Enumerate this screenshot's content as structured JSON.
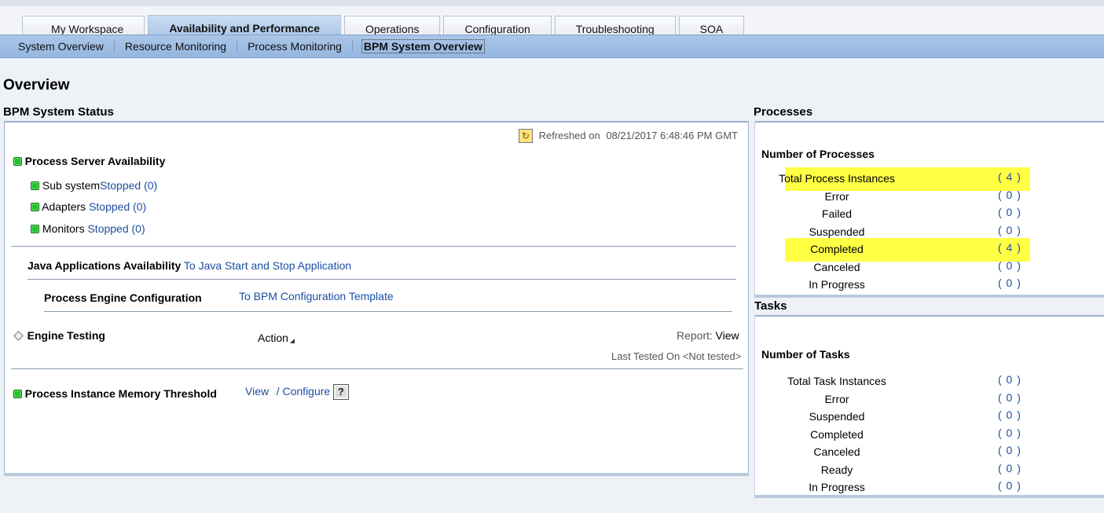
{
  "tabs": [
    "My Workspace",
    "Availability and Performance",
    "Operations",
    "Configuration",
    "Troubleshooting",
    "SOA"
  ],
  "active_tab": "Availability and Performance",
  "subnav": [
    "System Overview",
    "Resource Monitoring",
    "Process Monitoring",
    "BPM System Overview"
  ],
  "active_subnav": "BPM System Overview",
  "page_title": "Overview",
  "status": {
    "title": "BPM System Status",
    "refreshed_label": "Refreshed on",
    "refreshed_value": "08/21/2017 6:48:46 PM GMT",
    "server_availability": "Process Server Availability",
    "subsystem_label": "Sub system",
    "subsystem_link": "Stopped (0)",
    "adapters_label": "Adapters",
    "adapters_link": "Stopped (0)",
    "monitors_label": "Monitors",
    "monitors_link": "Stopped (0)",
    "java_label": "Java Applications Availability",
    "java_link": "To Java Start and Stop Application",
    "engine_config_label": "Process Engine Configuration",
    "engine_config_link": "To BPM Configuration Template",
    "engine_testing_label": "Engine Testing",
    "action_label": "Action",
    "report_label": "Report:",
    "report_link": "View",
    "last_tested_label": "Last Tested On",
    "last_tested_value": "<Not tested>",
    "memory_label": "Process Instance Memory Threshold",
    "memory_view": "View",
    "memory_configure": "/ Configure",
    "refresh_icon": "refresh-icon",
    "help_icon": "help-icon"
  },
  "processes": {
    "title": "Processes",
    "subtitle": "Number of Processes",
    "rows": [
      {
        "label": "Total Process Instances",
        "value": "( 4 )",
        "highlight": true
      },
      {
        "label": "Error",
        "value": "( 0 )",
        "highlight": false
      },
      {
        "label": "Failed",
        "value": "( 0 )",
        "highlight": false
      },
      {
        "label": "Suspended",
        "value": "( 0 )",
        "highlight": false
      },
      {
        "label": "Completed",
        "value": "( 4 )",
        "highlight": true
      },
      {
        "label": "Canceled",
        "value": "( 0 )",
        "highlight": false
      },
      {
        "label": "In Progress",
        "value": "( 0 )",
        "highlight": false
      }
    ]
  },
  "tasks": {
    "title": "Tasks",
    "subtitle": "Number of Tasks",
    "rows": [
      {
        "label": "Total Task Instances",
        "value": "( 0 )"
      },
      {
        "label": "Error",
        "value": "( 0 )"
      },
      {
        "label": "Suspended",
        "value": "( 0 )"
      },
      {
        "label": "Completed",
        "value": "( 0 )"
      },
      {
        "label": "Canceled",
        "value": "( 0 )"
      },
      {
        "label": "Ready",
        "value": "( 0 )"
      },
      {
        "label": "In Progress",
        "value": "( 0 )"
      }
    ]
  },
  "colors": {
    "highlight": "#ffff44",
    "link": "#1c4fa0",
    "status_green": "#23c12f"
  }
}
